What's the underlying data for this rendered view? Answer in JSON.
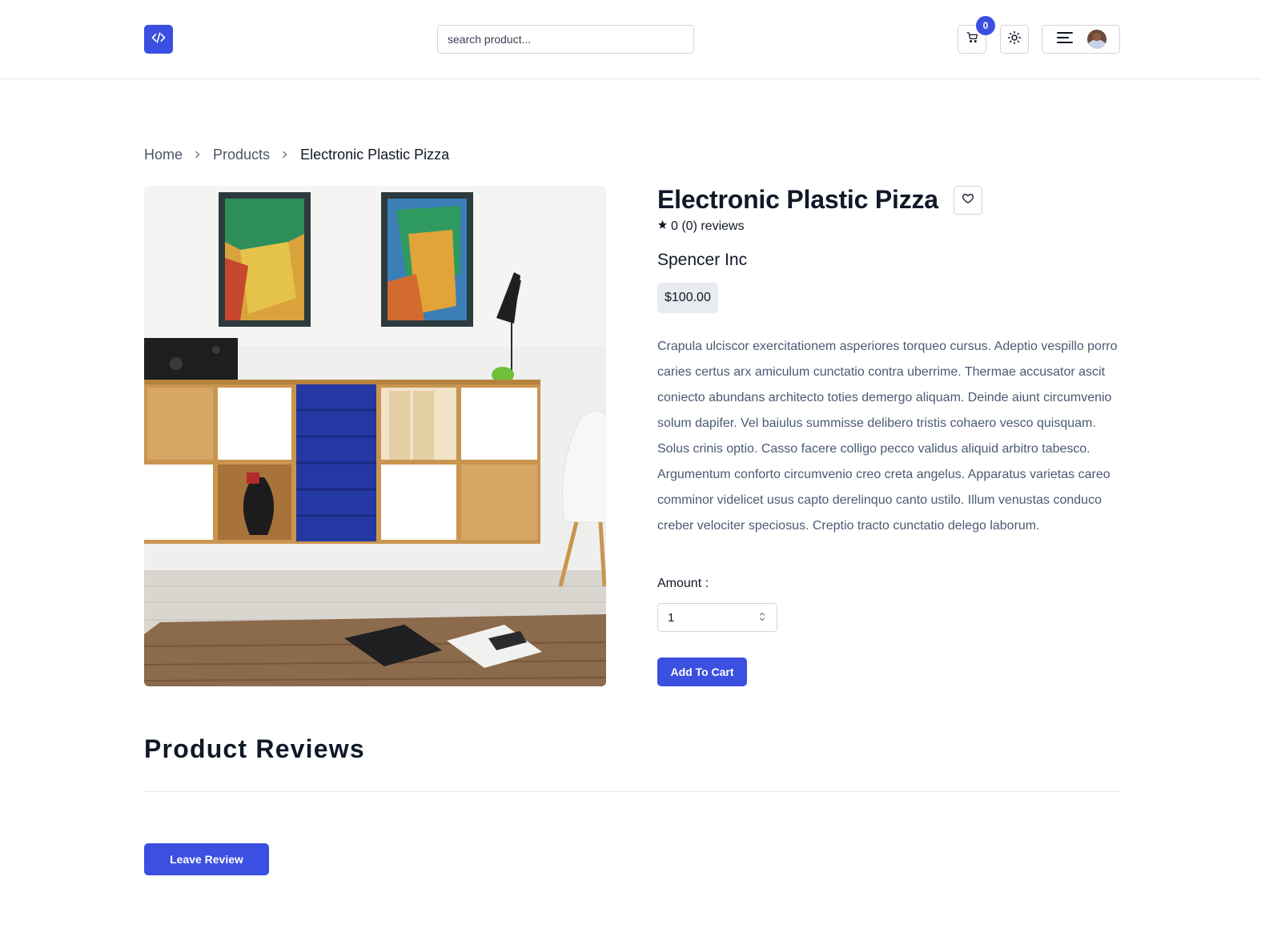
{
  "header": {
    "logo_icon": "code-icon",
    "search_placeholder": "search product...",
    "cart_count": "0",
    "cart_icon": "cart-icon",
    "theme_icon": "sun-icon",
    "menu_icon": "hamburger-icon"
  },
  "breadcrumb": {
    "items": [
      {
        "label": "Home"
      },
      {
        "label": "Products"
      }
    ],
    "current": "Electronic Plastic Pizza"
  },
  "product": {
    "title": "Electronic Plastic Pizza",
    "rating_text": "0 (0) reviews",
    "brand": "Spencer Inc",
    "price": "$100.00",
    "description": "Crapula ulciscor exercitationem asperiores torqueo cursus. Adeptio vespillo porro caries certus arx amiculum cunctatio contra uberrime. Thermae accusator ascit coniecto abundans architecto toties demergo aliquam. Deinde aiunt circumvenio solum dapifer. Vel baiulus summisse delibero tristis cohaero vesco quisquam. Solus crinis optio. Casso facere colligo pecco validus aliquid arbitro tabesco. Argumentum conforto circumvenio creo creta angelus. Apparatus varietas careo comminor videlicet usus capto derelinquo canto ustilo. Illum venustas conduco creber velociter speciosus. Creptio tracto cunctatio delego laborum.",
    "amount_label": "Amount :",
    "amount_value": "1",
    "add_to_cart_label": "Add To Cart"
  },
  "reviews": {
    "title": "Product Reviews",
    "leave_review_label": "Leave Review"
  },
  "colors": {
    "accent": "#3b4fe0",
    "price_bg": "#e8ebef",
    "description_text": "#4b5a73"
  }
}
